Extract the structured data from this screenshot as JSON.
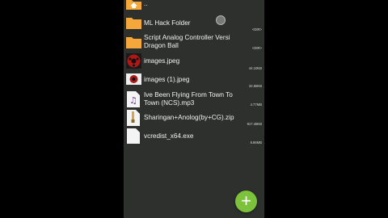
{
  "files": [
    {
      "name": "..",
      "meta": "",
      "icon": "parent-folder-icon"
    },
    {
      "name": "ML Hack Folder",
      "meta": "<DIR>",
      "icon": "folder-icon"
    },
    {
      "name": "Script Analog Controller Versi Dragon Ball",
      "line1": "Script Analog Controller Versi",
      "line2": "Dragon Ball",
      "meta": "<DIR>",
      "icon": "folder-icon"
    },
    {
      "name": "images.jpeg",
      "meta": "44.10KB",
      "icon": "image-thumbnail-icon"
    },
    {
      "name": "images (1).jpeg",
      "meta": "32.68KB",
      "icon": "image-thumbnail-icon"
    },
    {
      "name": "Ive Been Flying From Town To Town (NCS).mp3",
      "line1": "Ive Been Flying From Town To",
      "line2": "Town (NCS).mp3",
      "meta": "4.77MB",
      "icon": "music-file-icon"
    },
    {
      "name": "Sharingan+Anolog(by+CG).zip",
      "meta": "917.48KB",
      "icon": "zip-file-icon"
    },
    {
      "name": "vcredist_x64.exe",
      "meta": "6.86MB",
      "icon": "file-icon"
    }
  ],
  "fab": {
    "label": "+",
    "icon": "add-icon"
  },
  "colors": {
    "background": "#2e302e",
    "folder": "#f5a73b",
    "fab": "#7cc23b"
  }
}
